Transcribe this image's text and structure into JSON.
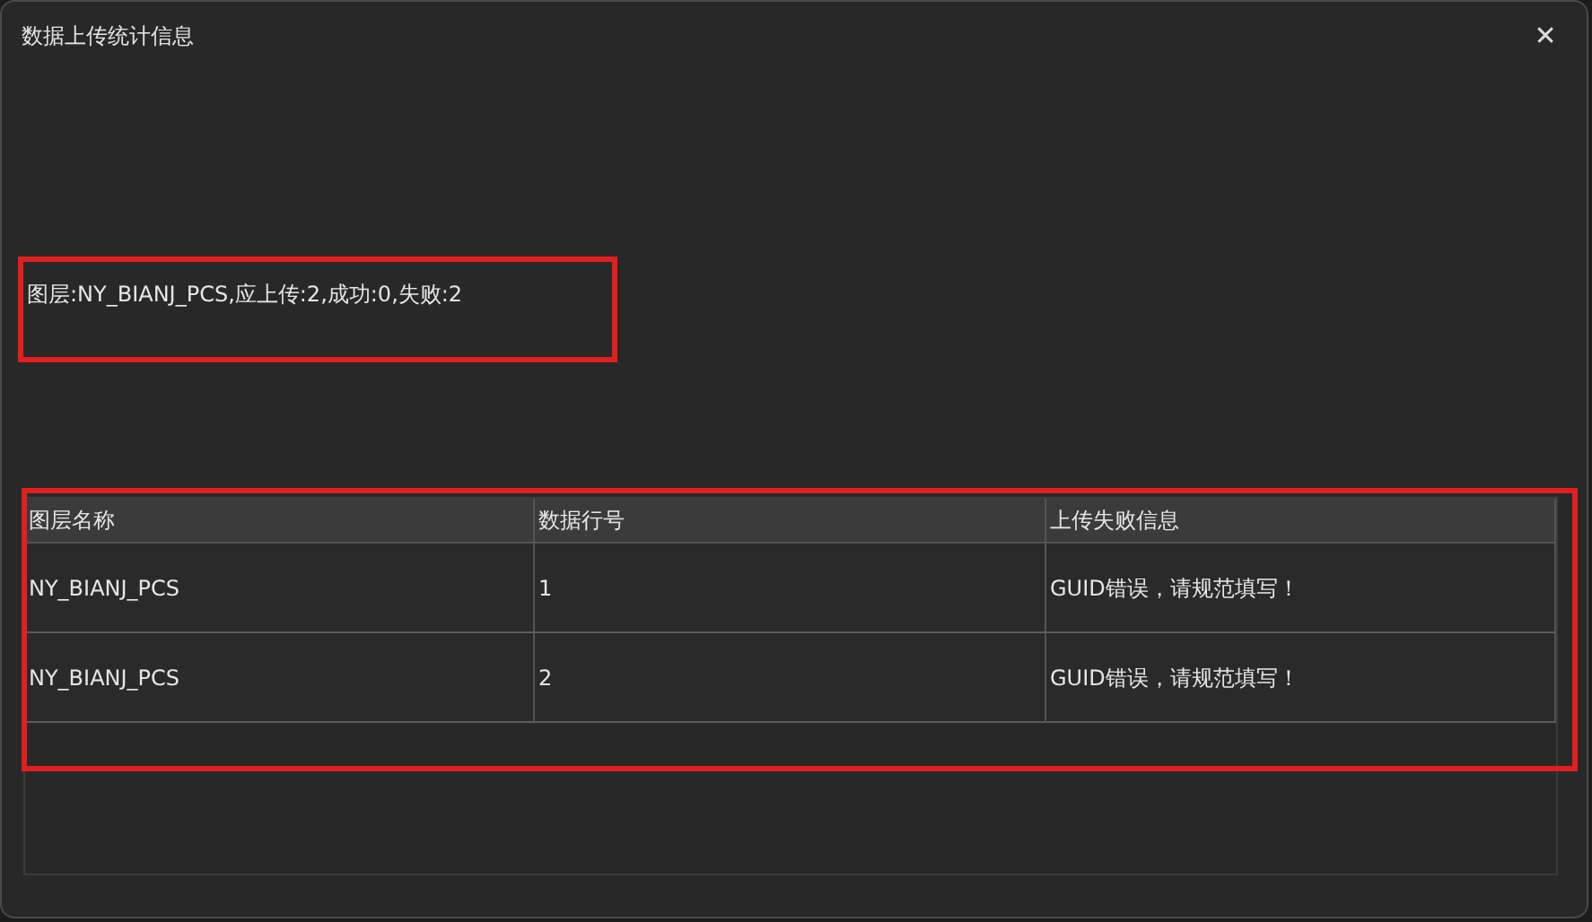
{
  "window": {
    "title": "数据上传统计信息",
    "close": "✕"
  },
  "summary": "图层:NY_BIANJ_PCS,应上传:2,成功:0,失败:2",
  "table": {
    "columns": [
      "图层名称",
      "数据行号",
      "上传失败信息"
    ],
    "rows": [
      [
        "NY_BIANJ_PCS",
        "1",
        "GUID错误，请规范填写！"
      ],
      [
        "NY_BIANJ_PCS",
        "2",
        "GUID错误，请规范填写！"
      ]
    ]
  }
}
